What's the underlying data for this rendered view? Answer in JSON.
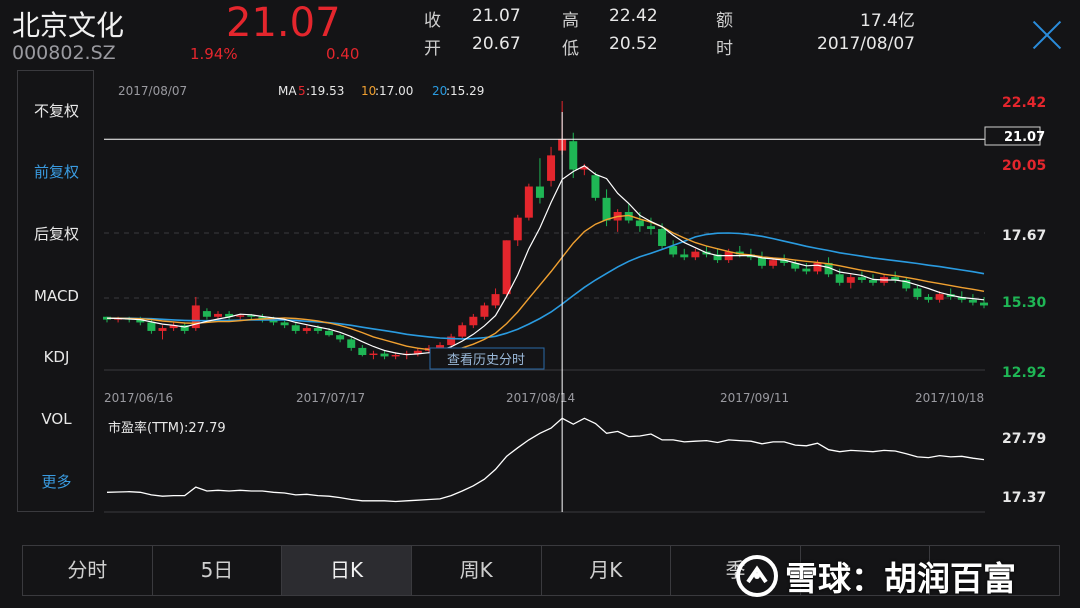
{
  "stock": {
    "name": "北京文化",
    "code": "000802.SZ",
    "price": "21.07",
    "pct": "1.94%",
    "change": "0.40"
  },
  "quote": {
    "close_label": "收",
    "close_value": "21.07",
    "high_label": "高",
    "high_value": "22.42",
    "amount_label": "额",
    "amount_value": "17.4亿",
    "open_label": "开",
    "open_value": "20.67",
    "low_label": "低",
    "low_value": "20.52",
    "time_label": "时",
    "time_value": "2017/08/07"
  },
  "sidebar": {
    "items": [
      {
        "label": "不复权",
        "active": false
      },
      {
        "label": "前复权",
        "active": true
      },
      {
        "label": "后复权",
        "active": false
      },
      {
        "label": "MACD",
        "active": false
      },
      {
        "label": "KDJ",
        "active": false
      },
      {
        "label": "VOL",
        "active": false
      },
      {
        "label": "更多",
        "active": true
      }
    ]
  },
  "chart": {
    "selected_date": "2017/08/07",
    "ma5_prefix": "MA",
    "ma5_num": "5",
    "ma5_value": ":19.53",
    "ma10_num": "10",
    "ma10_value": ":17.00",
    "ma20_num": "20",
    "ma20_value": ":15.29",
    "history_button": "查看历史分时",
    "pe_label": "市盈率(TTM):27.79",
    "crosshair_value": "21.07",
    "price_ticks": [
      "22.42",
      "20.05",
      "17.67",
      "15.30",
      "12.92"
    ],
    "pe_ticks": [
      "27.79",
      "17.37"
    ],
    "date_labels": [
      "2017/06/16",
      "2017/07/17",
      "2017/08/14",
      "2017/09/11",
      "2017/10/18"
    ]
  },
  "colors": {
    "up": "#e4262d",
    "down": "#1fb655",
    "ma5": "#ffffff",
    "ma10": "#f0a030",
    "ma20": "#2a9be0",
    "accent": "#3a9be0"
  },
  "chart_data": {
    "type": "candlestick",
    "ylim": [
      12.92,
      22.42
    ],
    "ohlc": [
      [
        14.8,
        14.8,
        14.6,
        14.7
      ],
      [
        14.7,
        14.8,
        14.6,
        14.75
      ],
      [
        14.75,
        14.8,
        14.6,
        14.7
      ],
      [
        14.7,
        14.8,
        14.5,
        14.6
      ],
      [
        14.6,
        14.7,
        14.2,
        14.3
      ],
      [
        14.3,
        14.5,
        14.0,
        14.4
      ],
      [
        14.4,
        14.6,
        14.3,
        14.5
      ],
      [
        14.5,
        14.6,
        14.2,
        14.3
      ],
      [
        14.4,
        15.5,
        14.3,
        15.2
      ],
      [
        15.0,
        15.1,
        14.7,
        14.8
      ],
      [
        14.8,
        15.0,
        14.7,
        14.9
      ],
      [
        14.9,
        15.0,
        14.7,
        14.8
      ],
      [
        14.8,
        14.9,
        14.7,
        14.85
      ],
      [
        14.85,
        14.9,
        14.7,
        14.8
      ],
      [
        14.8,
        14.9,
        14.6,
        14.7
      ],
      [
        14.7,
        14.8,
        14.5,
        14.6
      ],
      [
        14.6,
        14.7,
        14.4,
        14.5
      ],
      [
        14.5,
        14.6,
        14.2,
        14.3
      ],
      [
        14.3,
        14.5,
        14.2,
        14.4
      ],
      [
        14.4,
        14.5,
        14.2,
        14.3
      ],
      [
        14.3,
        14.4,
        14.1,
        14.15
      ],
      [
        14.15,
        14.2,
        13.9,
        14.0
      ],
      [
        14.0,
        14.1,
        13.6,
        13.7
      ],
      [
        13.7,
        13.8,
        13.4,
        13.45
      ],
      [
        13.45,
        13.6,
        13.3,
        13.5
      ],
      [
        13.5,
        13.6,
        13.3,
        13.4
      ],
      [
        13.4,
        13.55,
        13.3,
        13.45
      ],
      [
        13.45,
        13.6,
        13.3,
        13.5
      ],
      [
        13.5,
        13.7,
        13.4,
        13.6
      ],
      [
        13.6,
        13.8,
        13.5,
        13.7
      ],
      [
        13.7,
        13.9,
        13.6,
        13.8
      ],
      [
        13.8,
        14.2,
        13.7,
        14.1
      ],
      [
        14.1,
        14.6,
        14.0,
        14.5
      ],
      [
        14.5,
        14.9,
        14.4,
        14.8
      ],
      [
        14.8,
        15.3,
        14.7,
        15.2
      ],
      [
        15.2,
        15.8,
        15.1,
        15.6
      ],
      [
        15.6,
        17.5,
        15.5,
        17.5
      ],
      [
        17.5,
        18.4,
        17.3,
        18.3
      ],
      [
        18.3,
        19.5,
        18.2,
        19.4
      ],
      [
        19.4,
        20.4,
        18.8,
        19.0
      ],
      [
        19.6,
        20.8,
        19.4,
        20.5
      ],
      [
        20.67,
        22.42,
        20.52,
        21.07
      ],
      [
        21.0,
        21.3,
        19.7,
        20.0
      ],
      [
        20.0,
        20.2,
        19.8,
        20.1
      ],
      [
        19.8,
        19.9,
        18.9,
        19.0
      ],
      [
        19.0,
        19.3,
        18.0,
        18.2
      ],
      [
        18.2,
        18.6,
        17.8,
        18.5
      ],
      [
        18.5,
        18.8,
        18.1,
        18.2
      ],
      [
        18.2,
        18.5,
        17.8,
        18.0
      ],
      [
        18.0,
        18.3,
        17.7,
        17.9
      ],
      [
        17.9,
        18.1,
        17.2,
        17.3
      ],
      [
        17.3,
        17.5,
        16.9,
        17.0
      ],
      [
        17.0,
        17.2,
        16.8,
        16.9
      ],
      [
        16.9,
        17.2,
        16.8,
        17.1
      ],
      [
        17.1,
        17.3,
        16.9,
        17.0
      ],
      [
        17.0,
        17.2,
        16.7,
        16.8
      ],
      [
        16.8,
        17.2,
        16.7,
        17.1
      ],
      [
        17.1,
        17.3,
        16.9,
        17.0
      ],
      [
        17.0,
        17.2,
        16.8,
        16.9
      ],
      [
        16.9,
        17.1,
        16.5,
        16.6
      ],
      [
        16.6,
        16.9,
        16.5,
        16.8
      ],
      [
        16.8,
        17.0,
        16.6,
        16.7
      ],
      [
        16.7,
        16.8,
        16.4,
        16.5
      ],
      [
        16.5,
        16.7,
        16.3,
        16.4
      ],
      [
        16.4,
        16.8,
        16.3,
        16.7
      ],
      [
        16.7,
        16.9,
        16.2,
        16.3
      ],
      [
        16.3,
        16.5,
        15.9,
        16.0
      ],
      [
        16.0,
        16.3,
        15.8,
        16.2
      ],
      [
        16.2,
        16.4,
        16.0,
        16.1
      ],
      [
        16.1,
        16.3,
        15.9,
        16.0
      ],
      [
        16.0,
        16.3,
        15.9,
        16.2
      ],
      [
        16.2,
        16.4,
        16.0,
        16.1
      ],
      [
        16.1,
        16.2,
        15.7,
        15.8
      ],
      [
        15.8,
        15.9,
        15.4,
        15.5
      ],
      [
        15.5,
        15.6,
        15.3,
        15.4
      ],
      [
        15.4,
        15.7,
        15.3,
        15.6
      ],
      [
        15.6,
        15.8,
        15.4,
        15.5
      ],
      [
        15.5,
        15.7,
        15.3,
        15.4
      ],
      [
        15.4,
        15.6,
        15.2,
        15.3
      ],
      [
        15.3,
        15.5,
        15.1,
        15.2
      ]
    ],
    "ma5": [
      14.75,
      14.74,
      14.72,
      14.7,
      14.62,
      14.54,
      14.5,
      14.44,
      14.54,
      14.64,
      14.72,
      14.79,
      14.89,
      14.87,
      14.81,
      14.76,
      14.71,
      14.6,
      14.52,
      14.44,
      14.36,
      14.25,
      14.1,
      13.92,
      13.75,
      13.61,
      13.52,
      13.46,
      13.49,
      13.53,
      13.61,
      13.74,
      13.94,
      14.18,
      14.48,
      14.84,
      15.52,
      16.28,
      17.2,
      17.94,
      18.84,
      19.65,
      19.93,
      20.13,
      19.83,
      19.68,
      19.16,
      18.8,
      18.38,
      18.16,
      17.98,
      17.68,
      17.42,
      17.24,
      17.06,
      16.96,
      16.96,
      16.96,
      16.96,
      16.88,
      16.84,
      16.8,
      16.7,
      16.6,
      16.62,
      16.54,
      16.38,
      16.32,
      16.26,
      16.12,
      16.1,
      16.1,
      16.04,
      15.92,
      15.8,
      15.66,
      15.56,
      15.48,
      15.44,
      15.4
    ],
    "ma10": [
      14.75,
      14.75,
      14.74,
      14.73,
      14.7,
      14.65,
      14.62,
      14.58,
      14.57,
      14.6,
      14.63,
      14.63,
      14.66,
      14.7,
      14.72,
      14.74,
      14.76,
      14.74,
      14.7,
      14.65,
      14.58,
      14.49,
      14.38,
      14.24,
      14.09,
      13.98,
      13.87,
      13.76,
      13.69,
      13.64,
      13.6,
      13.62,
      13.7,
      13.83,
      14.0,
      14.22,
      14.56,
      14.97,
      15.45,
      15.92,
      16.4,
      16.9,
      17.4,
      17.81,
      18.07,
      18.23,
      18.34,
      18.38,
      18.25,
      18.14,
      17.98,
      17.76,
      17.58,
      17.42,
      17.3,
      17.2,
      17.1,
      17.02,
      16.98,
      16.92,
      16.88,
      16.85,
      16.8,
      16.76,
      16.72,
      16.67,
      16.6,
      16.52,
      16.44,
      16.38,
      16.3,
      16.25,
      16.19,
      16.12,
      16.04,
      15.97,
      15.9,
      15.83,
      15.77,
      15.7
    ],
    "ma20": [
      14.75,
      14.75,
      14.75,
      14.74,
      14.73,
      14.71,
      14.69,
      14.67,
      14.66,
      14.66,
      14.67,
      14.67,
      14.68,
      14.69,
      14.69,
      14.69,
      14.69,
      14.67,
      14.64,
      14.62,
      14.59,
      14.55,
      14.5,
      14.43,
      14.37,
      14.31,
      14.25,
      14.18,
      14.13,
      14.09,
      14.05,
      14.03,
      14.02,
      14.03,
      14.06,
      14.11,
      14.22,
      14.36,
      14.54,
      14.74,
      14.97,
      15.25,
      15.55,
      15.84,
      16.1,
      16.33,
      16.56,
      16.76,
      16.92,
      17.04,
      17.18,
      17.32,
      17.47,
      17.62,
      17.71,
      17.75,
      17.76,
      17.74,
      17.7,
      17.64,
      17.56,
      17.47,
      17.38,
      17.29,
      17.21,
      17.14,
      17.06,
      17.0,
      16.94,
      16.88,
      16.83,
      16.78,
      16.73,
      16.68,
      16.62,
      16.57,
      16.51,
      16.45,
      16.39,
      16.32
    ],
    "pe_ylim": [
      15.3,
      29.8
    ],
    "pe": [
      18.0,
      18.05,
      18.1,
      18.0,
      17.6,
      17.4,
      17.5,
      17.5,
      18.8,
      18.2,
      18.3,
      18.2,
      18.3,
      18.2,
      18.2,
      18.0,
      17.9,
      17.6,
      17.7,
      17.5,
      17.4,
      17.2,
      16.9,
      16.7,
      16.7,
      16.7,
      16.6,
      16.7,
      16.8,
      16.9,
      17.0,
      17.5,
      18.2,
      19.0,
      20.0,
      21.5,
      23.5,
      24.8,
      26.0,
      27.0,
      27.8,
      29.3,
      28.4,
      29.3,
      28.5,
      27.0,
      27.3,
      26.5,
      26.6,
      26.9,
      26.0,
      26.0,
      25.7,
      25.8,
      25.9,
      25.6,
      26.0,
      25.9,
      25.8,
      25.4,
      25.7,
      25.7,
      25.2,
      25.1,
      25.5,
      24.5,
      24.2,
      24.4,
      24.3,
      24.2,
      24.4,
      24.3,
      23.9,
      23.4,
      23.3,
      23.6,
      23.4,
      23.5,
      23.2,
      23.0
    ]
  }
}
